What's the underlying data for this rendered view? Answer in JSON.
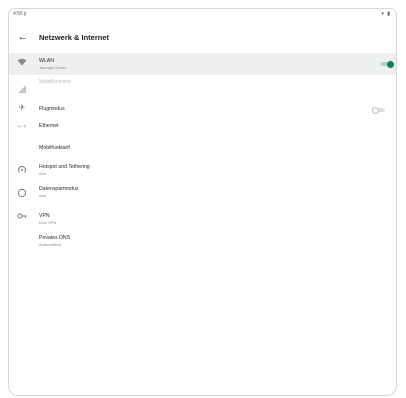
{
  "statusbar": {
    "time": "4:55",
    "left_icon": "vpn-key-icon",
    "right_icons": "▾ ▮"
  },
  "appbar": {
    "back_icon": "arrow-back-icon",
    "title": "Netzwerk & Internet"
  },
  "items": [
    {
      "label": "WLAN",
      "sublabel": "Tsuragui Guest",
      "icon": "wifi-icon",
      "toggle": "on",
      "selected": true
    },
    {
      "label": "Mobilfunknetz",
      "icon": "signal-icon",
      "disabled": true
    },
    {
      "label": "Flugmodus",
      "icon": "airplane-icon",
      "toggle": "off"
    },
    {
      "label": "Ethernet",
      "icon": "ethernet-icon"
    },
    {
      "label": "Mobilfunktarif"
    },
    {
      "label": "Hotspot und Tethering",
      "sublabel": "Aus",
      "icon": "hotspot-icon"
    },
    {
      "label": "Datensparmodus",
      "sublabel": "Aus",
      "icon": "data-saver-icon"
    },
    {
      "label": "VPN",
      "sublabel": "Kein VPN",
      "icon": "vpn-icon"
    },
    {
      "label": "Privates DNS",
      "sublabel": "Automatisch"
    }
  ],
  "colors": {
    "accent": "#127d5f",
    "accent_track": "#9fd8c6",
    "selected_row": "#eef0ef"
  }
}
